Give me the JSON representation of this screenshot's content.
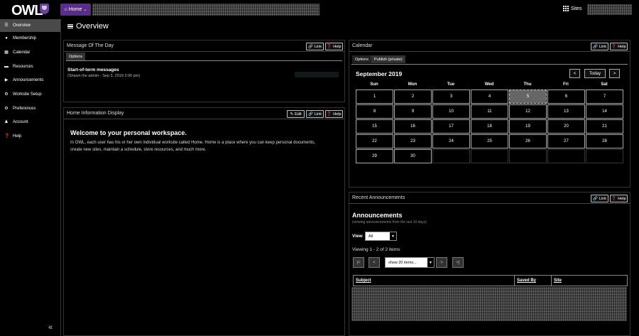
{
  "topbar": {
    "logo_text": "OWL",
    "home_label": "Home",
    "sites_label": "Sites"
  },
  "sidebar": {
    "items": [
      {
        "label": "Overview",
        "icon": "list-icon"
      },
      {
        "label": "Membership",
        "icon": "users-icon"
      },
      {
        "label": "Calendar",
        "icon": "calendar-icon"
      },
      {
        "label": "Resources",
        "icon": "folder-icon"
      },
      {
        "label": "Announcements",
        "icon": "bullhorn-icon"
      },
      {
        "label": "Worksite Setup",
        "icon": "gears-icon"
      },
      {
        "label": "Preferences",
        "icon": "gear-icon"
      },
      {
        "label": "Account",
        "icon": "user-icon"
      },
      {
        "label": "Help",
        "icon": "question-icon"
      }
    ],
    "collapse_glyph": "«"
  },
  "page": {
    "title": "Overview"
  },
  "motd": {
    "title": "Message Of The Day",
    "link_label": "Link",
    "help_label": "Help",
    "tab_label": "Options",
    "message_title": "Start-of-term messages",
    "message_meta": "(Shawn the admin - Sep 3, 2019 3:00 pm)"
  },
  "home_info": {
    "title": "Home Information Display",
    "edit_label": "Edit",
    "link_label": "Link",
    "help_label": "Help",
    "heading": "Welcome to your personal workspace.",
    "body": "In OWL, each user has his or her own individual worksite called Home. Home is a place where you can keep personal documents, create new sites, maintain a schedule, store resources, and much more."
  },
  "calendar": {
    "title": "Calendar",
    "link_label": "Link",
    "help_label": "Help",
    "tabs": [
      "Options",
      "Publish (private)"
    ],
    "month_label": "September 2019",
    "prev_glyph": "<",
    "today_label": "Today",
    "next_glyph": ">",
    "weekdays": [
      "Sun",
      "Mon",
      "Tue",
      "Wed",
      "Thu",
      "Fri",
      "Sat"
    ],
    "days": [
      "1",
      "2",
      "3",
      "4",
      "5",
      "6",
      "7",
      "8",
      "9",
      "10",
      "11",
      "12",
      "13",
      "14",
      "15",
      "16",
      "17",
      "18",
      "19",
      "20",
      "21",
      "22",
      "23",
      "24",
      "25",
      "26",
      "27",
      "28",
      "29",
      "30"
    ],
    "today_day": "5"
  },
  "announcements": {
    "title": "Recent Announcements",
    "link_label": "Link",
    "help_label": "Help",
    "heading": "Announcements",
    "subtitle": "(viewing announcements from the last 10 days)",
    "view_label": "View",
    "view_value": "All",
    "viewing_text": "Viewing 1 - 2 of 2 items",
    "first_glyph": "|<",
    "prev_glyph": "<",
    "page_size_value": "show 20 items...",
    "next_glyph": ">",
    "last_glyph": ">|",
    "columns": [
      "Subject",
      "Saved By",
      "Site"
    ]
  },
  "colors": {
    "accent": "#5a2d8c",
    "background": "#000000",
    "active_sidebar": "#4a4a4a"
  }
}
